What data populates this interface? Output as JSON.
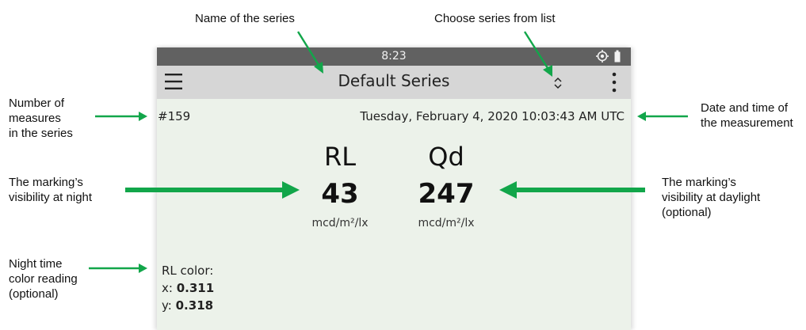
{
  "annotations": {
    "series_name": "Name of the series",
    "choose_series": "Choose series from list",
    "measure_count": [
      "Number of",
      "measures",
      "in the series"
    ],
    "datetime": [
      "Date and time of",
      "the measurement"
    ],
    "night_visibility": [
      "The marking’s",
      "visibility at night"
    ],
    "day_visibility": [
      "The marking’s",
      "visibility at daylight",
      "(optional)"
    ],
    "night_color": [
      "Night time",
      "color reading",
      "(optional)"
    ]
  },
  "status_bar": {
    "time": "8:23",
    "icons": [
      "location-icon",
      "battery-icon"
    ]
  },
  "app_bar": {
    "title": "Default Series",
    "icons": [
      "menu-icon",
      "chevron-up-down-icon",
      "more-vertical-icon"
    ]
  },
  "measurement": {
    "count": "#159",
    "datetime": "Tuesday, February 4, 2020 10:03:43 AM UTC",
    "rl": {
      "label": "RL",
      "value": "43",
      "unit": "mcd/m²/lx"
    },
    "qd": {
      "label": "Qd",
      "value": "247",
      "unit": "mcd/m²/lx"
    },
    "rl_color": {
      "heading": "RL color:",
      "x_label": "x:",
      "x_value": "0.311",
      "y_label": "y:",
      "y_value": "0.318"
    }
  },
  "colors": {
    "arrow_green": "#12a64a",
    "status_bar": "#616161",
    "app_bar": "#d6d6d6",
    "screen_background": "#ecf2ea"
  }
}
